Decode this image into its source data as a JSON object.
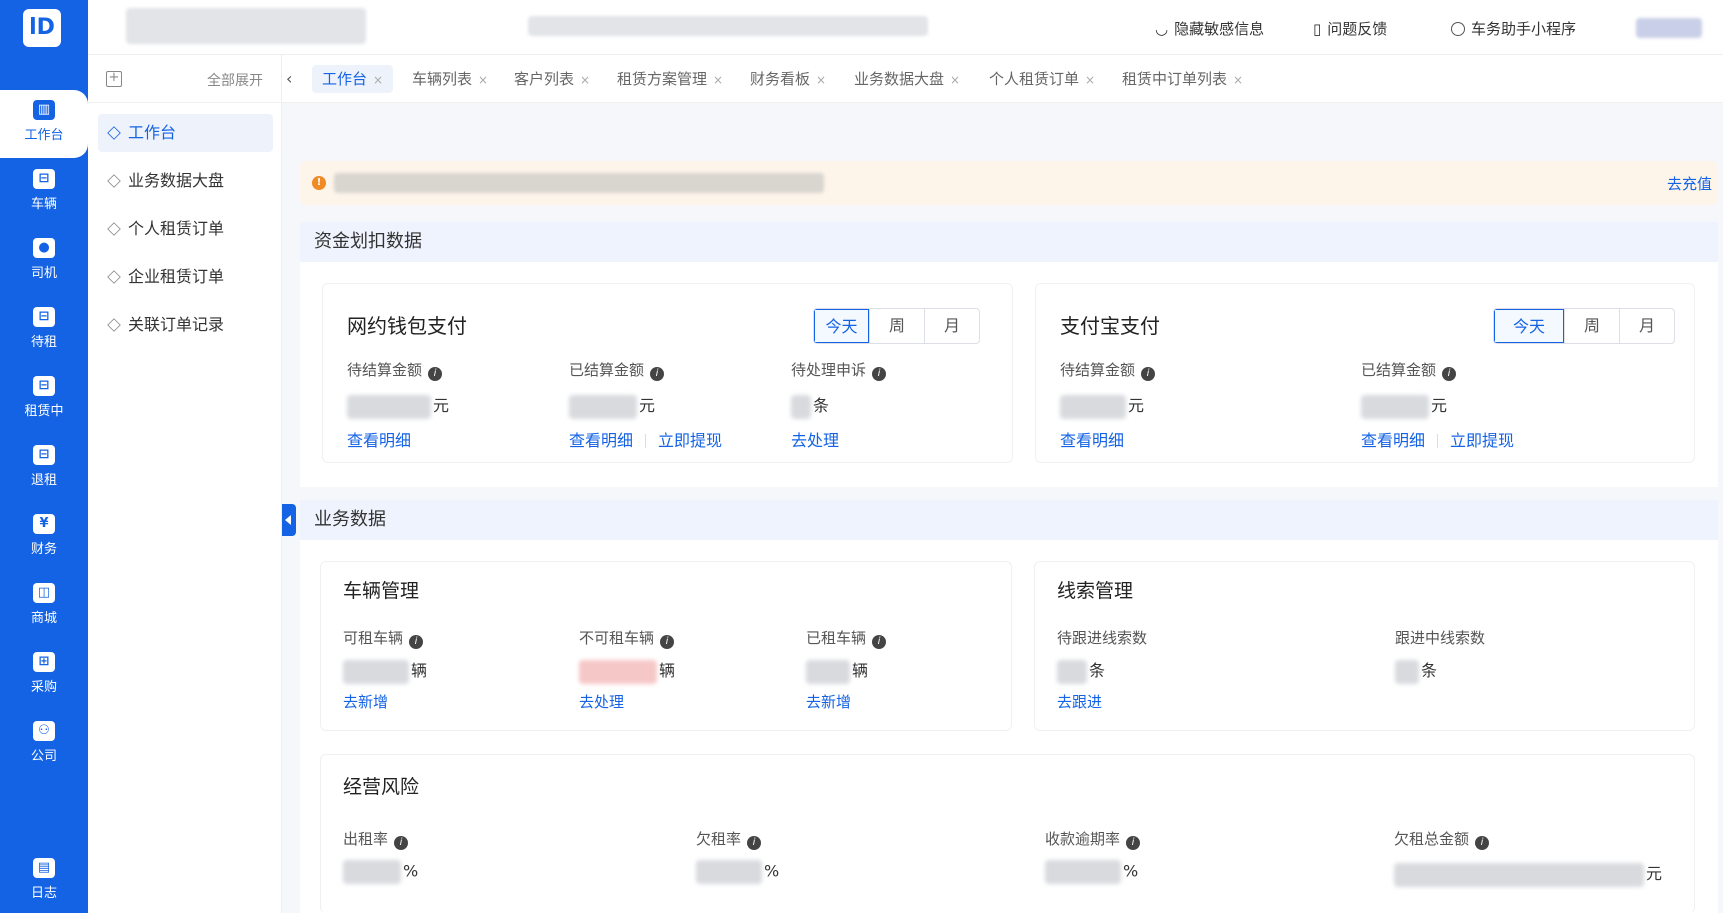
{
  "rail": {
    "logo": "lD",
    "items": [
      {
        "label": "工作台",
        "icon": "dashboard-icon",
        "glyph": "▥"
      },
      {
        "label": "车辆",
        "icon": "car-icon",
        "glyph": "⊟"
      },
      {
        "label": "司机",
        "icon": "driver-icon",
        "glyph": "●"
      },
      {
        "label": "待租",
        "icon": "car-waiting-icon",
        "glyph": "⊟"
      },
      {
        "label": "租赁中",
        "icon": "car-renting-icon",
        "glyph": "⊟"
      },
      {
        "label": "退租",
        "icon": "car-return-icon",
        "glyph": "⊟"
      },
      {
        "label": "财务",
        "icon": "yuan-icon",
        "glyph": "¥"
      },
      {
        "label": "商城",
        "icon": "shop-bag-icon",
        "glyph": "◫"
      },
      {
        "label": "采购",
        "icon": "basket-icon",
        "glyph": "⊞"
      },
      {
        "label": "公司",
        "icon": "company-icon",
        "glyph": "⚇"
      },
      {
        "label": "日志",
        "icon": "log-icon",
        "glyph": "▤"
      }
    ]
  },
  "topbar": {
    "hide_sensitive": "隐藏敏感信息",
    "feedback": "问题反馈",
    "mini_program": "车务助手小程序"
  },
  "submenu": {
    "expand_all": "全部展开",
    "items": [
      "工作台",
      "业务数据大盘",
      "个人租赁订单",
      "企业租赁订单",
      "关联订单记录"
    ]
  },
  "tabs": [
    "工作台",
    "车辆列表",
    "客户列表",
    "租赁方案管理",
    "财务看板",
    "业务数据大盘",
    "个人租赁订单",
    "租赁中订单列表"
  ],
  "notice": {
    "action": "去充值"
  },
  "funds": {
    "title": "资金划扣数据",
    "periods": [
      "今天",
      "周",
      "月"
    ],
    "wallet": {
      "title": "网约钱包支付",
      "pending_label": "待结算金额",
      "pending_unit": "元",
      "pending_link": "查看明细",
      "settled_label": "已结算金额",
      "settled_unit": "元",
      "settled_link": "查看明细",
      "withdraw_link": "立即提现",
      "appeal_label": "待处理申诉",
      "appeal_unit": "条",
      "appeal_link": "去处理"
    },
    "alipay": {
      "title": "支付宝支付",
      "pending_label": "待结算金额",
      "pending_unit": "元",
      "pending_link": "查看明细",
      "settled_label": "已结算金额",
      "settled_unit": "元",
      "settled_link": "查看明细",
      "withdraw_link": "立即提现"
    }
  },
  "business": {
    "title": "业务数据",
    "vehicles": {
      "title": "车辆管理",
      "rentable_label": "可租车辆",
      "rentable_unit": "辆",
      "rentable_link": "去新增",
      "unrentable_label": "不可租车辆",
      "unrentable_unit": "辆",
      "unrentable_link": "去处理",
      "rented_label": "已租车辆",
      "rented_unit": "辆",
      "rented_link": "去新增"
    },
    "leads": {
      "title": "线索管理",
      "pending_label": "待跟进线索数",
      "pending_unit": "条",
      "pending_link": "去跟进",
      "following_label": "跟进中线索数",
      "following_unit": "条"
    },
    "risk": {
      "title": "经营风险",
      "rent_rate_label": "出租率",
      "rent_rate_unit": "%",
      "arrears_rate_label": "欠租率",
      "arrears_rate_unit": "%",
      "overdue_rate_label": "收款逾期率",
      "overdue_rate_unit": "%",
      "arrears_total_label": "欠租总金额",
      "arrears_total_unit": "元"
    }
  }
}
